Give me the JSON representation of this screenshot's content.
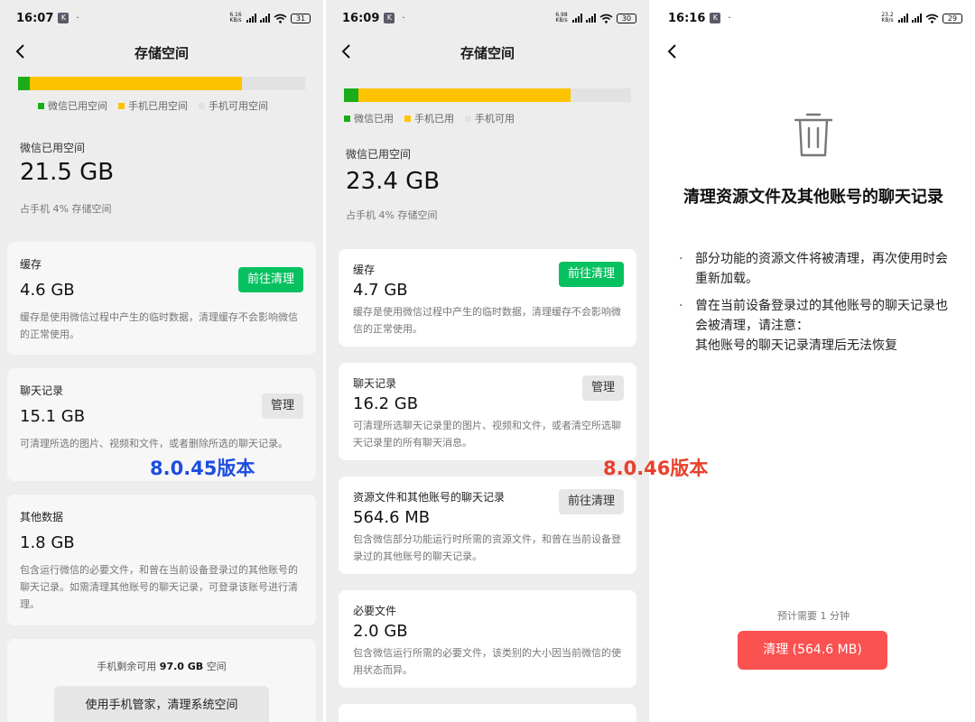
{
  "colors": {
    "wechat": "#1aad19",
    "phone": "#fdc300",
    "free": "#e2e2e2",
    "accent_green": "#07c160",
    "danger": "#fa5151",
    "label_blue": "#1d4ee0",
    "label_red": "#e8412c"
  },
  "left": {
    "status": {
      "time": "16:07",
      "badge": "K",
      "dot": "·",
      "speed_top": "6.16",
      "speed_bottom": "KB/s",
      "battery": "31"
    },
    "nav": {
      "title": "存储空间"
    },
    "usage_fraction": {
      "wechat": 0.04,
      "phone": 0.74
    },
    "legend": [
      "微信已用空间",
      "手机已用空间",
      "手机可用空间"
    ],
    "wechat_used_label": "微信已用空间",
    "wechat_used_size": "21.5 GB",
    "wechat_used_share": "占手机 4% 存储空间",
    "cards": [
      {
        "title": "缓存",
        "size": "4.6 GB",
        "button": "前往清理",
        "desc": "缓存是使用微信过程中产生的临时数据，清理缓存不会影响微信的正常使用。"
      },
      {
        "title": "聊天记录",
        "size": "15.1 GB",
        "button": "管理",
        "desc": "可清理所选的图片、视频和文件，或者删除所选的聊天记录。"
      },
      {
        "title": "其他数据",
        "size": "1.8 GB",
        "desc": "包含运行微信的必要文件，和曾在当前设备登录过的其他账号的聊天记录。如需清理其他账号的聊天记录，可登录该账号进行清理。"
      }
    ],
    "free_prefix": "手机剩余可用",
    "free_value": "97.0 GB",
    "free_suffix": "空间",
    "manager_button": "使用手机管家，清理系统空间",
    "version_label": "8.0.45版本"
  },
  "middle": {
    "status": {
      "time": "16:09",
      "badge": "K",
      "dot": "·",
      "speed_top": "6.98",
      "speed_bottom": "KB/s",
      "battery": "30"
    },
    "nav": {
      "title": "存储空间"
    },
    "usage_fraction": {
      "wechat": 0.05,
      "phone": 0.74
    },
    "legend": [
      "微信已用",
      "手机已用",
      "手机可用"
    ],
    "wechat_used_label": "微信已用空间",
    "wechat_used_size": "23.4 GB",
    "wechat_used_share": "占手机 4% 存储空间",
    "cards": [
      {
        "title": "缓存",
        "size": "4.7 GB",
        "button": "前往清理",
        "desc": "缓存是使用微信过程中产生的临时数据，清理缓存不会影响微信的正常使用。"
      },
      {
        "title": "聊天记录",
        "size": "16.2 GB",
        "button": "管理",
        "desc": "可清理所选聊天记录里的图片、视频和文件，或者清空所选聊天记录里的所有聊天消息。"
      },
      {
        "title": "资源文件和其他账号的聊天记录",
        "size": "564.6 MB",
        "button": "前往清理",
        "desc": "包含微信部分功能运行时所需的资源文件，和曾在当前设备登录过的其他账号的聊天记录。"
      },
      {
        "title": "必要文件",
        "size": "2.0 GB",
        "desc": "包含微信运行所需的必要文件，该类别的大小因当前微信的使用状态而异。"
      }
    ],
    "version_label": "8.0.46版本"
  },
  "right": {
    "status": {
      "time": "16:16",
      "badge": "K",
      "dot": "·",
      "speed_top": "23.2",
      "speed_bottom": "KB/s",
      "battery": "29"
    },
    "heading": "清理资源文件及其他账号的聊天记录",
    "bullets": [
      "部分功能的资源文件将被清理，再次使用时会重新加载。",
      "曾在当前设备登录过的其他账号的聊天记录也会被清理，请注意：\n其他账号的聊天记录清理后无法恢复"
    ],
    "bullet_mark": "·",
    "estimate": "预计需要 1 分钟",
    "clean_button": "清理 (564.6 MB)"
  }
}
